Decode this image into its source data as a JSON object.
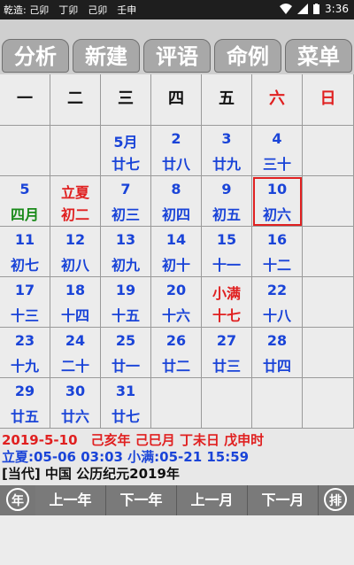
{
  "statusbar": {
    "text": "乾造: 己卯　丁卯　己卯　壬申",
    "time": "3:36"
  },
  "tabs": [
    {
      "label": "分析"
    },
    {
      "label": "新建"
    },
    {
      "label": "评语"
    },
    {
      "label": "命例"
    },
    {
      "label": "菜单"
    }
  ],
  "weekdays": [
    "一",
    "二",
    "三",
    "四",
    "五",
    "六",
    "日"
  ],
  "days": [
    {
      "num": "5月",
      "lunar": "廿七",
      "col": 2,
      "row": 0
    },
    {
      "num": "2",
      "lunar": "廿八",
      "col": 3,
      "row": 0
    },
    {
      "num": "3",
      "lunar": "廿九",
      "col": 4,
      "row": 0
    },
    {
      "num": "4",
      "lunar": "三十",
      "col": 5,
      "row": 0
    },
    {
      "num": "5",
      "lunar": "四月",
      "col": 0,
      "row": 1,
      "lunarColor": "#1a8a1a"
    },
    {
      "num": "立夏",
      "lunar": "初二",
      "col": 1,
      "row": 1,
      "numColor": "#e02020",
      "lunarColor": "#e02020"
    },
    {
      "num": "7",
      "lunar": "初三",
      "col": 2,
      "row": 1
    },
    {
      "num": "8",
      "lunar": "初四",
      "col": 3,
      "row": 1
    },
    {
      "num": "9",
      "lunar": "初五",
      "col": 4,
      "row": 1
    },
    {
      "num": "10",
      "lunar": "初六",
      "col": 5,
      "row": 1,
      "selected": true
    },
    {
      "num": "11",
      "lunar": "初七",
      "col": 0,
      "row": 2
    },
    {
      "num": "12",
      "lunar": "初八",
      "col": 1,
      "row": 2
    },
    {
      "num": "13",
      "lunar": "初九",
      "col": 2,
      "row": 2
    },
    {
      "num": "14",
      "lunar": "初十",
      "col": 3,
      "row": 2
    },
    {
      "num": "15",
      "lunar": "十一",
      "col": 4,
      "row": 2
    },
    {
      "num": "16",
      "lunar": "十二",
      "col": 5,
      "row": 2
    },
    {
      "num": "17",
      "lunar": "十三",
      "col": 0,
      "row": 3
    },
    {
      "num": "18",
      "lunar": "十四",
      "col": 1,
      "row": 3
    },
    {
      "num": "19",
      "lunar": "十五",
      "col": 2,
      "row": 3
    },
    {
      "num": "20",
      "lunar": "十六",
      "col": 3,
      "row": 3
    },
    {
      "num": "小满",
      "lunar": "十七",
      "col": 4,
      "row": 3,
      "numColor": "#e02020",
      "lunarColor": "#e02020"
    },
    {
      "num": "22",
      "lunar": "十八",
      "col": 5,
      "row": 3
    },
    {
      "num": "23",
      "lunar": "十九",
      "col": 0,
      "row": 4
    },
    {
      "num": "24",
      "lunar": "二十",
      "col": 1,
      "row": 4
    },
    {
      "num": "25",
      "lunar": "廿一",
      "col": 2,
      "row": 4
    },
    {
      "num": "26",
      "lunar": "廿二",
      "col": 3,
      "row": 4
    },
    {
      "num": "27",
      "lunar": "廿三",
      "col": 4,
      "row": 4
    },
    {
      "num": "28",
      "lunar": "廿四",
      "col": 5,
      "row": 4
    },
    {
      "num": "29",
      "lunar": "廿五",
      "col": 0,
      "row": 5
    },
    {
      "num": "30",
      "lunar": "廿六",
      "col": 1,
      "row": 5
    },
    {
      "num": "31",
      "lunar": "廿七",
      "col": 2,
      "row": 5
    }
  ],
  "info": {
    "line1": "2019-5-10　己亥年 己巳月 丁未日 戊申时",
    "line2": "立夏:05-06 03:03  小满:05-21 15:59",
    "line3": "[当代] 中国  公历纪元2019年"
  },
  "bottom": {
    "left_circle": "年",
    "prev_year": "上一年",
    "next_year": "下一年",
    "prev_month": "上一月",
    "next_month": "下一月",
    "right_circle": "排"
  },
  "colors": {
    "blue": "#1a44d8",
    "red": "#e02020",
    "green": "#1a8a1a"
  }
}
